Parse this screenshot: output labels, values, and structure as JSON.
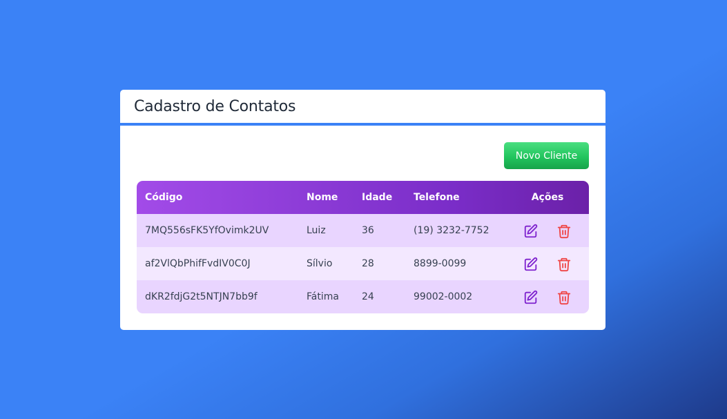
{
  "card": {
    "title": "Cadastro de Contatos"
  },
  "toolbar": {
    "new_client_label": "Novo Cliente"
  },
  "table": {
    "headers": [
      "Código",
      "Nome",
      "Idade",
      "Telefone",
      "Ações"
    ],
    "rows": [
      {
        "codigo": "7MQ556sFK5YfOvimk2UV",
        "nome": "Luiz",
        "idade": "36",
        "telefone": "(19) 3232-7752"
      },
      {
        "codigo": "af2VlQbPhifFvdIV0C0J",
        "nome": "Sílvio",
        "idade": "28",
        "telefone": "8899-0099"
      },
      {
        "codigo": "dKR2fdjG2t5NTJN7bb9f",
        "nome": "Fátima",
        "idade": "24",
        "telefone": "99002-0002"
      }
    ],
    "row_actions": [
      "edit-icon",
      "trash-icon"
    ]
  },
  "colors": {
    "background": "#3b82f6",
    "accent_border": "#3b82f6",
    "button_green": "#22c55e",
    "header_purple": "#8e3dd8",
    "row_odd": "#e9d5ff",
    "row_even": "#f3e8ff",
    "edit_icon": "#7e22ce",
    "trash_icon": "#ef4444"
  }
}
